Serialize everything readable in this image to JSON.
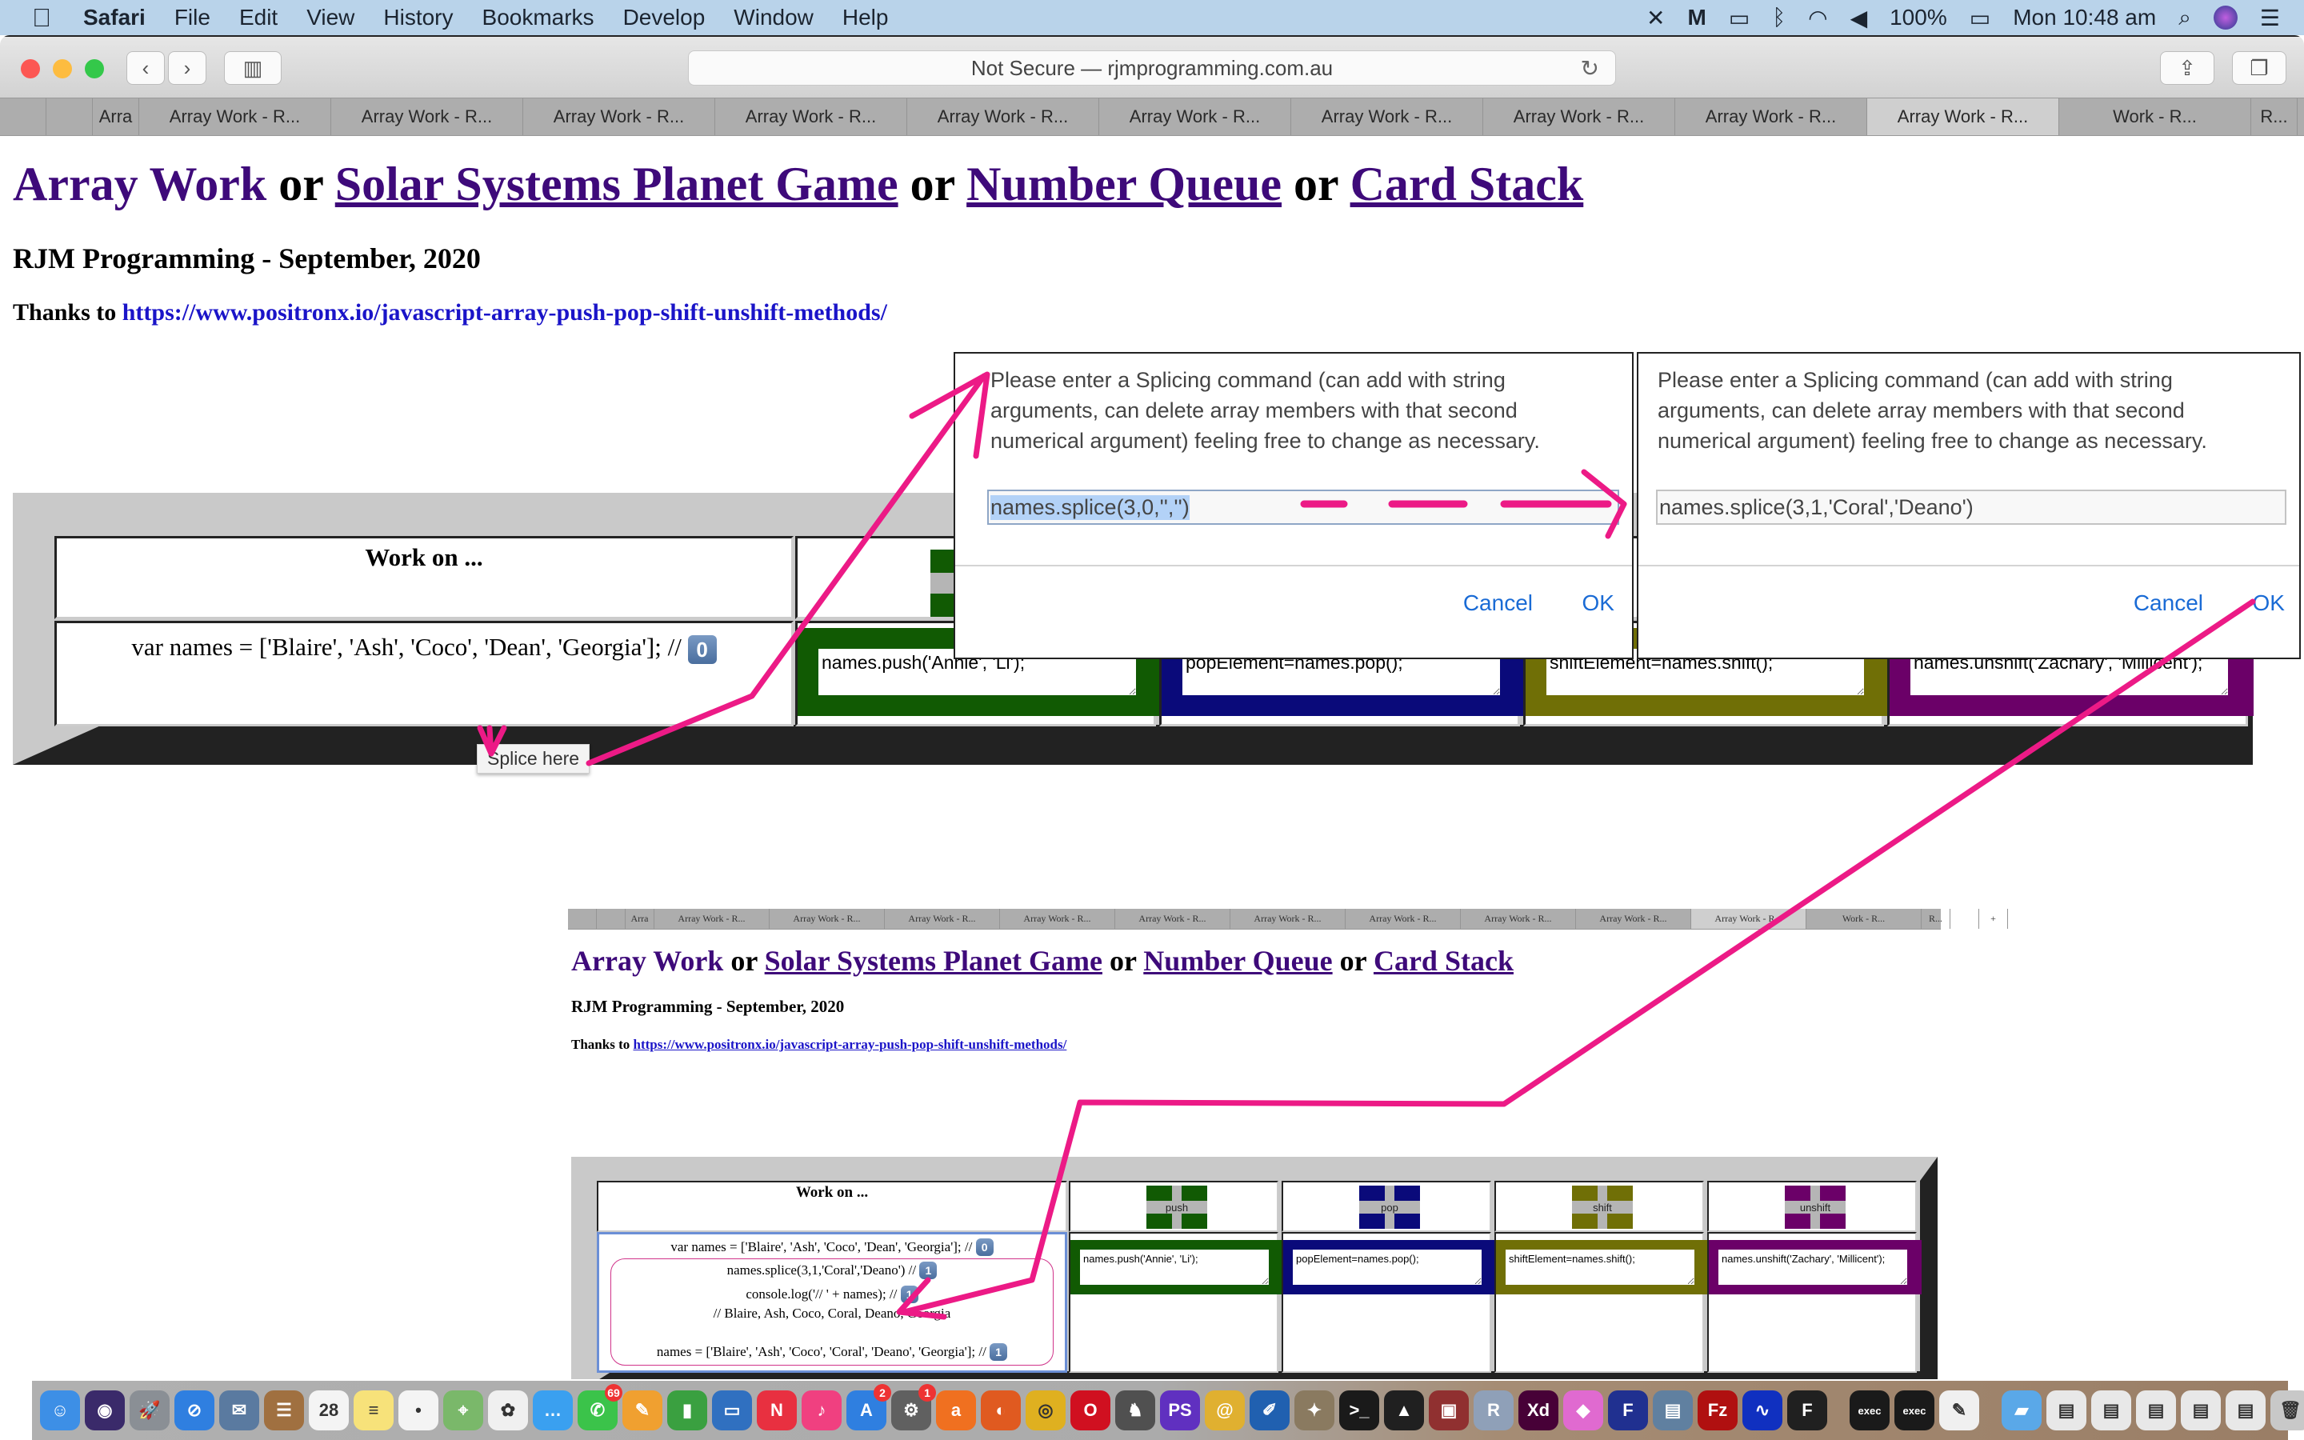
{
  "menubar": {
    "app_name": "Safari",
    "items": [
      "File",
      "Edit",
      "View",
      "History",
      "Bookmarks",
      "Develop",
      "Window",
      "Help"
    ],
    "status": {
      "battery": "100%",
      "clock": "Mon 10:48 am"
    },
    "icons": [
      "avast-icon",
      "malwarebytes-icon",
      "airplay-icon",
      "bluetooth-icon",
      "wifi-icon",
      "volume-icon",
      "battery-icon",
      "spotlight-icon",
      "siri-icon",
      "notification-center-icon"
    ]
  },
  "toolbar": {
    "url_text": "Not Secure — rjmprogramming.com.au",
    "back": "‹",
    "forward": "›"
  },
  "tabs": {
    "items": [
      "",
      "",
      "Arra",
      "Array Work - R...",
      "Array Work - R...",
      "Array Work - R...",
      "Array Work - R...",
      "Array Work - R...",
      "Array Work - R...",
      "Array Work - R...",
      "Array Work - R...",
      "Array Work - R...",
      "Array Work - R...",
      "Work - R...",
      "R...",
      "",
      ""
    ],
    "active_index": 12,
    "new_tab": "+"
  },
  "page": {
    "title_parts": {
      "t1": "Array Work",
      "or": "or",
      "t2": "Solar Systems Planet Game",
      "t3": "Number Queue",
      "t4": "Card Stack"
    },
    "subtitle": "RJM Programming - September, 2020",
    "thanks_label": "Thanks to",
    "thanks_link": "https://www.positronx.io/javascript-array-push-pop-shift-unshift-methods/",
    "table": {
      "header_work": "Work on ...",
      "code_line": "var names = ['Blaire', 'Ash', 'Coco', 'Dean', 'Georgia']; //",
      "badge0": "0",
      "ops": [
        {
          "name": "push",
          "code": "names.push('Annie', 'Li');",
          "color": "#115a03"
        },
        {
          "name": "pop",
          "code": "popElement=names.pop();",
          "color": "#0a0a7a"
        },
        {
          "name": "shift",
          "code": "shiftElement=names.shift();",
          "color": "#706f06"
        },
        {
          "name": "unshift",
          "code": "names.unshift('Zachary', 'Millicent');",
          "color": "#6b0068"
        }
      ]
    },
    "tooltip": "Splice here"
  },
  "dialogs": [
    {
      "message": "Please enter a Splicing command (can add with string arguments, can delete array members with that second numerical argument) feeling free to change as necessary.",
      "value": "names.splice(3,0,'','')",
      "cancel": "Cancel",
      "ok": "OK"
    },
    {
      "message": "Please enter a Splicing command (can add with string arguments, can delete array members with that second numerical argument) feeling free to change as necessary.",
      "value": "names.splice(3,1,'Coral','Deano')",
      "cancel": "Cancel",
      "ok": "OK"
    }
  ],
  "inset": {
    "tabs": [
      "",
      "",
      "Arra",
      "Array Work - R...",
      "Array Work - R...",
      "Array Work - R...",
      "Array Work - R...",
      "Array Work - R...",
      "Array Work - R...",
      "Array Work - R...",
      "Array Work - R...",
      "Array Work - R...",
      "Array Work - R...",
      "Work - R...",
      "R...",
      ""
    ],
    "active_index": 12,
    "lines": {
      "code_line": "var names = ['Blaire', 'Ash', 'Coco', 'Dean', 'Georgia']; //",
      "badge0": "0",
      "splice_line": "names.splice(3,1,'Coral','Deano') //",
      "log_line": "console.log('// ' + names); //",
      "result_line": "// Blaire, Ash, Coco, Coral, Deano, Georgia",
      "names_line": "names = ['Blaire', 'Ash', 'Coco', 'Coral', 'Deano', 'Georgia']; //",
      "badge1": "1"
    }
  },
  "annotations": {
    "arrow_color": "#ec1a86"
  },
  "dock": {
    "apps": [
      {
        "name": "finder",
        "glyph": "☺",
        "color": "#3d8fe6"
      },
      {
        "name": "siri",
        "glyph": "◉",
        "color": "#3a2a6a"
      },
      {
        "name": "launchpad",
        "glyph": "🚀",
        "color": "#8a8f95"
      },
      {
        "name": "safari",
        "glyph": "⊘",
        "color": "#2f7fe0"
      },
      {
        "name": "mail",
        "glyph": "✉",
        "color": "#5a7aa0"
      },
      {
        "name": "contacts",
        "glyph": "☰",
        "color": "#a07040"
      },
      {
        "name": "calendar",
        "glyph": "28",
        "color": "#f4f4f4"
      },
      {
        "name": "notes",
        "glyph": "≡",
        "color": "#f7e27a"
      },
      {
        "name": "reminders",
        "glyph": "•",
        "color": "#f4f4f4"
      },
      {
        "name": "maps",
        "glyph": "⌖",
        "color": "#7ab86a"
      },
      {
        "name": "photos",
        "glyph": "✿",
        "color": "#f0f0f0"
      },
      {
        "name": "messages",
        "glyph": "…",
        "color": "#3aa0f0"
      },
      {
        "name": "facetime",
        "glyph": "✆",
        "color": "#3bc34a",
        "badge": "69"
      },
      {
        "name": "pages",
        "glyph": "✎",
        "color": "#f0a030"
      },
      {
        "name": "numbers",
        "glyph": "▮",
        "color": "#3aa040"
      },
      {
        "name": "keynote",
        "glyph": "▭",
        "color": "#3070c0"
      },
      {
        "name": "news",
        "glyph": "N",
        "color": "#e83040"
      },
      {
        "name": "music",
        "glyph": "♪",
        "color": "#f04080"
      },
      {
        "name": "app-store",
        "glyph": "A",
        "color": "#2f7fe0",
        "badge": "2"
      },
      {
        "name": "system-preferences",
        "glyph": "⚙",
        "color": "#606060",
        "badge": "1"
      },
      {
        "name": "avast",
        "glyph": "a",
        "color": "#f07020"
      },
      {
        "name": "firefox",
        "glyph": "◐",
        "color": "#e05a20"
      },
      {
        "name": "chrome",
        "glyph": "◎",
        "color": "#dfb020"
      },
      {
        "name": "opera",
        "glyph": "O",
        "color": "#d01020"
      },
      {
        "name": "mamp",
        "glyph": "♞",
        "color": "#505050"
      },
      {
        "name": "phpstorm",
        "glyph": "PS",
        "color": "#6030c0"
      },
      {
        "name": "eclipse",
        "glyph": "@",
        "color": "#e0b030"
      },
      {
        "name": "xcode",
        "glyph": "✐",
        "color": "#2060b0"
      },
      {
        "name": "gimp",
        "glyph": "✦",
        "color": "#8a7a60"
      },
      {
        "name": "terminal",
        "glyph": ">_",
        "color": "#1a1a1a"
      },
      {
        "name": "inkscape",
        "glyph": "▲",
        "color": "#202020"
      },
      {
        "name": "photo-booth",
        "glyph": "▣",
        "color": "#903030"
      },
      {
        "name": "r",
        "glyph": "R",
        "color": "#8fa0b8"
      },
      {
        "name": "adobe-xd",
        "glyph": "Xd",
        "color": "#470137"
      },
      {
        "name": "sketch",
        "glyph": "◆",
        "color": "#e06ad0"
      },
      {
        "name": "flowchart",
        "glyph": "F",
        "color": "#203090"
      },
      {
        "name": "preview",
        "glyph": "▤",
        "color": "#6080a0"
      },
      {
        "name": "filezilla",
        "glyph": "Fz",
        "color": "#b01010"
      },
      {
        "name": "audacity",
        "glyph": "∿",
        "color": "#1030c0"
      },
      {
        "name": "f-app",
        "glyph": "F",
        "color": "#202020"
      },
      {
        "name": "sep",
        "glyph": "",
        "color": ""
      },
      {
        "name": "exec-1",
        "glyph": "exec",
        "color": "#1a1a1a"
      },
      {
        "name": "exec-2",
        "glyph": "exec",
        "color": "#1a1a1a"
      },
      {
        "name": "textedit",
        "glyph": "✎",
        "color": "#f0f0f0"
      },
      {
        "name": "sep",
        "glyph": "",
        "color": ""
      },
      {
        "name": "downloads-folder",
        "glyph": "▰",
        "color": "#5aa8e8"
      },
      {
        "name": "window-1",
        "glyph": "▤",
        "color": "#e8e8e8"
      },
      {
        "name": "window-2",
        "glyph": "▤",
        "color": "#e8e8e8"
      },
      {
        "name": "window-3",
        "glyph": "▤",
        "color": "#e8e8e8"
      },
      {
        "name": "window-4",
        "glyph": "▤",
        "color": "#e8e8e8"
      },
      {
        "name": "window-5",
        "glyph": "▤",
        "color": "#e8e8e8"
      },
      {
        "name": "trash",
        "glyph": "🗑",
        "color": "#c8c8c8"
      }
    ]
  }
}
